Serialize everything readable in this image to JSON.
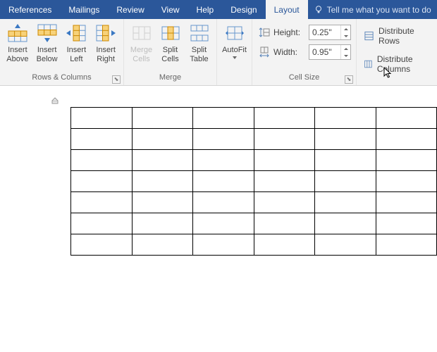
{
  "tabs": {
    "references": "References",
    "mailings": "Mailings",
    "review": "Review",
    "view": "View",
    "help": "Help",
    "design": "Design",
    "layout": "Layout"
  },
  "tell_me": {
    "placeholder": "Tell me what you want to do"
  },
  "groups": {
    "rows_columns": {
      "label": "Rows & Columns",
      "insert_above": "Insert Above",
      "insert_below": "Insert Below",
      "insert_left": "Insert Left",
      "insert_right": "Insert Right"
    },
    "merge": {
      "label": "Merge",
      "merge_cells": "Merge Cells",
      "split_cells": "Split Cells",
      "split_table": "Split Table"
    },
    "autofit": {
      "label": "AutoFit"
    },
    "cell_size": {
      "label": "Cell Size",
      "height_label": "Height:",
      "height_value": "0.25\"",
      "width_label": "Width:",
      "width_value": "0.95\""
    },
    "distribute": {
      "rows": "Distribute Rows",
      "cols": "Distribute Columns"
    }
  },
  "table_grid": {
    "rows": 7,
    "cols": 6
  }
}
